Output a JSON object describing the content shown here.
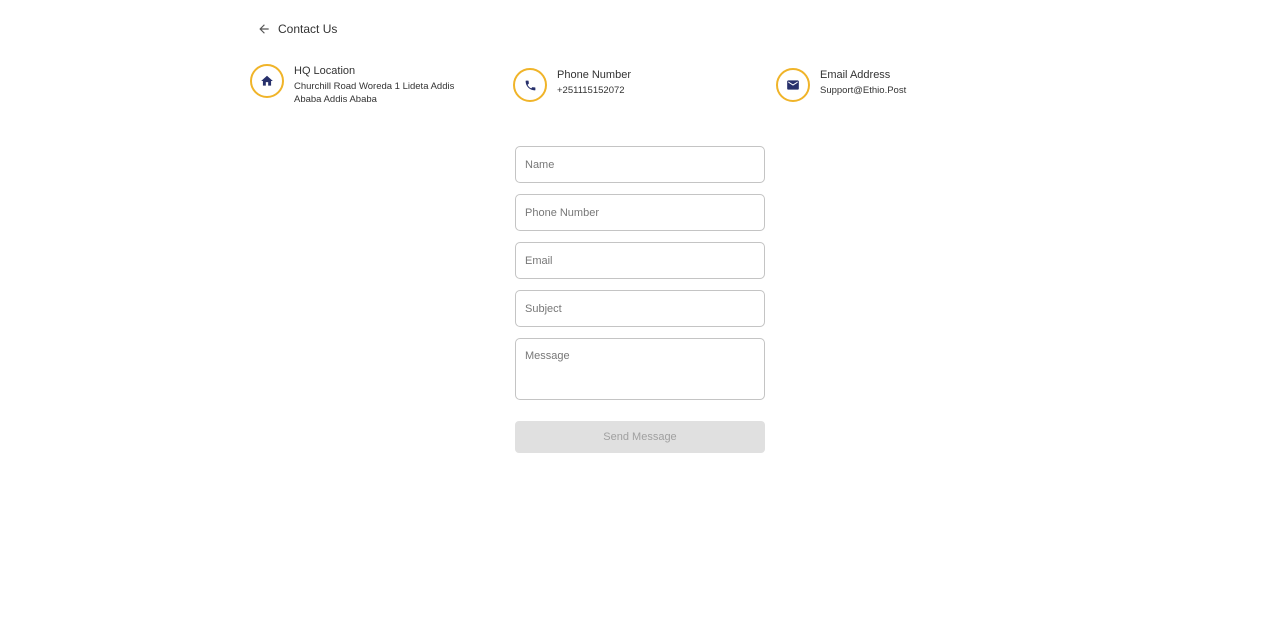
{
  "header": {
    "back_icon": "arrow-left-icon",
    "title": "Contact Us"
  },
  "contact_info": {
    "hq": {
      "icon": "home-icon",
      "title": "HQ Location",
      "value": "Churchill Road Woreda 1 Lideta Addis Ababa Addis Ababa"
    },
    "phone": {
      "icon": "phone-icon",
      "title": "Phone Number",
      "value": "+251115152072"
    },
    "email": {
      "icon": "mail-icon",
      "title": "Email Address",
      "value": "Support@Ethio.Post"
    }
  },
  "form": {
    "name_placeholder": "Name",
    "phone_placeholder": "Phone Number",
    "email_placeholder": "Email",
    "subject_placeholder": "Subject",
    "message_placeholder": "Message",
    "send_label": "Send Message",
    "send_disabled": true
  },
  "colors": {
    "icon_ring": "#f0b429",
    "icon_fill": "#27306b",
    "button_disabled_bg": "#e0e0e0",
    "button_disabled_text": "#a0a0a0"
  }
}
